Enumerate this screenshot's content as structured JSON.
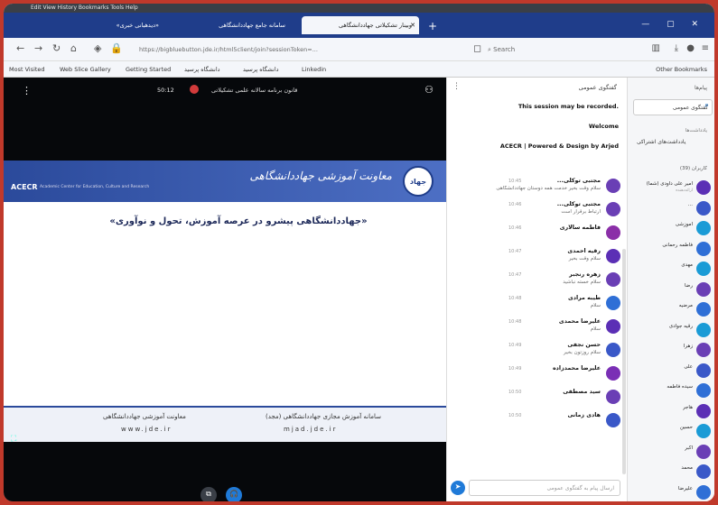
{
  "browser": {
    "menubar": "Edit   View   History   Bookmarks   Tools   Help",
    "tabs": [
      {
        "label": "«دیدهبانی خبری»"
      },
      {
        "label": "سامانه جامع جهاددانشگاهی"
      },
      {
        "label": "وبینار تشکیلاتی جهاددانشگاهی"
      }
    ],
    "url": "https://bigbluebutton.jde.ir/html5client/join?sessionToken=...",
    "search_placeholder": "Search",
    "bookmarks": [
      "Most Visited",
      "Web Slice Gallery",
      "Getting Started",
      "دانشگاه پرسید",
      "دانشگاه پرسید",
      "Linkedin"
    ],
    "other_bookmarks": "Other Bookmarks"
  },
  "video": {
    "title": "قانون برنامه سالانه علمی تشکیلاتی",
    "time": "50:12",
    "slide": {
      "logo_text": "ACECR",
      "logo_sub": "Academic Center for Education, Culture and Research",
      "org_name": "معاونت آموزشی جهاددانشگاهی",
      "emblem": "جهاد",
      "title": "«جهاددانشگاهی پیشرو در عرصه آموزش، تحول و نوآوری»",
      "footer_left_title": "معاونت آموزشی جهاددانشگاهی",
      "footer_left_url": "www.jde.ir",
      "footer_right_title": "سامانه آموزش مجازی جهاددانشگاهی (مجد)",
      "footer_right_url": "mjad.jde.ir"
    }
  },
  "chat": {
    "header": "گفتگوی عمومی",
    "notice_lines": [
      "This session may be recorded.",
      "Welcome",
      "ACECR | Powered & Design by Arjed"
    ],
    "messages": [
      {
        "name": "مجتبی توکلی...",
        "text": "سلام وقت بخیر خدمت همه دوستان جهاددانشگاهی",
        "time": "10:45",
        "color": "#6a3fb5"
      },
      {
        "name": "مجتبی توکلی...",
        "text": "ارتباط برقرار است",
        "time": "10:46",
        "color": "#6a3fb5"
      },
      {
        "name": "فاطمه سالاری",
        "text": "",
        "time": "10:46",
        "color": "#8b2fa8"
      },
      {
        "name": "رقیه احمدی",
        "text": "سلام وقت بخیر",
        "time": "10:47",
        "color": "#5b2fb5"
      },
      {
        "name": "زهره رنجبر",
        "text": "سلام خسته نباشید",
        "time": "10:47",
        "color": "#6a3fb5"
      },
      {
        "name": "طیبه مرادی",
        "text": "سلام",
        "time": "10:48",
        "color": "#2f6fd6"
      },
      {
        "name": "علیرضا محمدی",
        "text": "سلام",
        "time": "10:48",
        "color": "#5b2fb5"
      },
      {
        "name": "حسن نجفی",
        "text": "سلام روزتون بخیر",
        "time": "10:49",
        "color": "#3a58c8"
      },
      {
        "name": "علیرضا محمدزاده",
        "text": "",
        "time": "10:49",
        "color": "#7a2fb5"
      },
      {
        "name": "سید مصطفی",
        "text": "",
        "time": "10:50",
        "color": "#6a3fb5"
      },
      {
        "name": "هادی زمانی",
        "text": "",
        "time": "10:50",
        "color": "#3a58c8"
      }
    ],
    "input_placeholder": "ارسال پیام به گفتگوی عمومی"
  },
  "users": {
    "header": "پیام‌ها",
    "search_label": "گفتگوی عمومی",
    "notes_title": "یادداشت‌ها",
    "notes_label": "یادداشت‌های اشتراکی",
    "count_label": "کاربران (39)",
    "list": [
      {
        "name": "امیر علی داودی (شما)",
        "sub": "ارائه‌دهنده",
        "color": "#5b2fb5"
      },
      {
        "name": "...",
        "sub": "",
        "color": "#3a58c8"
      },
      {
        "name": "آموزشی",
        "sub": "",
        "color": "#1a9bd6"
      },
      {
        "name": "فاطمه رحمانی",
        "sub": "",
        "color": "#2f6fd6"
      },
      {
        "name": "مهدی",
        "sub": "",
        "color": "#1a9bd6"
      },
      {
        "name": "رضا",
        "sub": "",
        "color": "#6a3fb5"
      },
      {
        "name": "مرضیه",
        "sub": "",
        "color": "#2f6fd6"
      },
      {
        "name": "رقیه جوادی",
        "sub": "",
        "color": "#1a9bd6"
      },
      {
        "name": "زهرا",
        "sub": "",
        "color": "#6a3fb5"
      },
      {
        "name": "علی",
        "sub": "",
        "color": "#3a58c8"
      },
      {
        "name": "سیده فاطمه",
        "sub": "",
        "color": "#2f6fd6"
      },
      {
        "name": "هاجر",
        "sub": "",
        "color": "#5b2fb5"
      },
      {
        "name": "حسین",
        "sub": "",
        "color": "#1a9bd6"
      },
      {
        "name": "اکبر",
        "sub": "",
        "color": "#6a3fb5"
      },
      {
        "name": "محمد",
        "sub": "",
        "color": "#3a58c8"
      },
      {
        "name": "علیرضا",
        "sub": "",
        "color": "#2f6fd6"
      },
      {
        "name": "طیبه",
        "sub": "",
        "color": "#1a9bd6"
      }
    ]
  }
}
